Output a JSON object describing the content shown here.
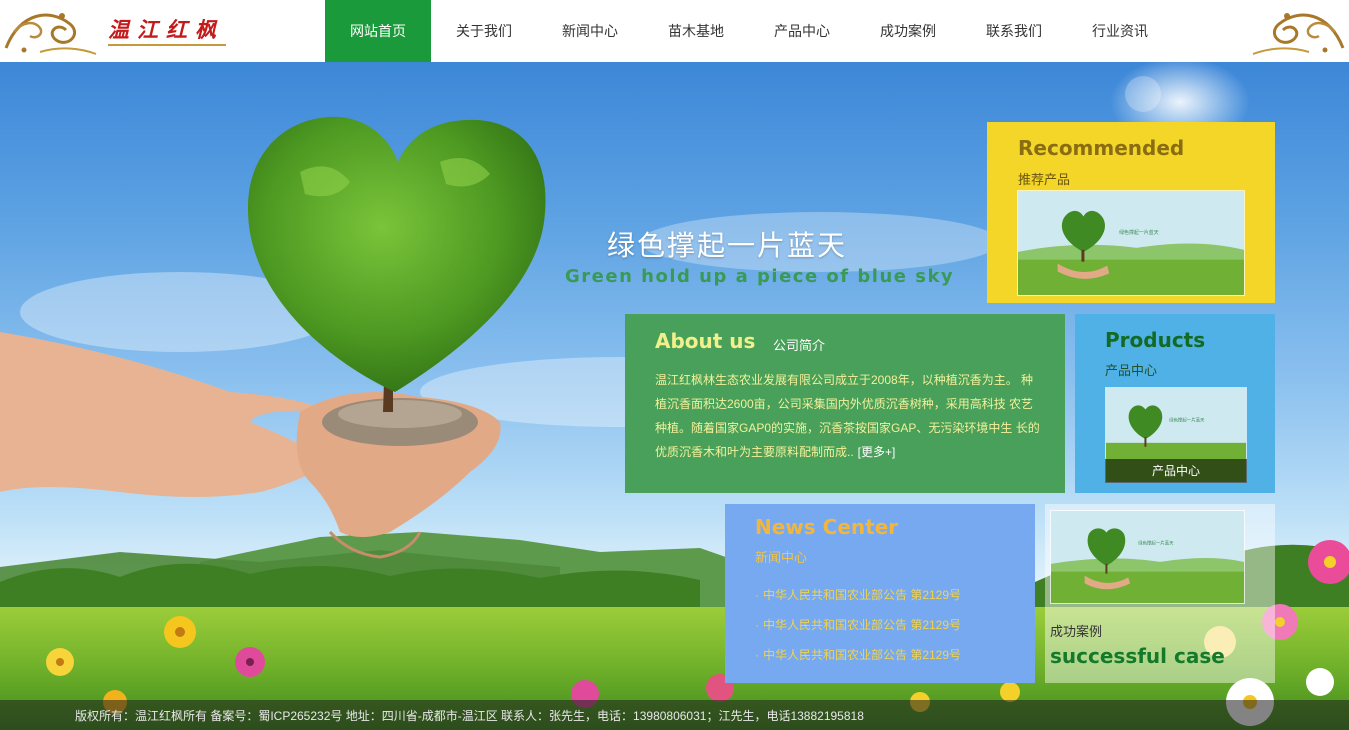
{
  "logo": {
    "text": "温江红枫"
  },
  "nav": {
    "items": [
      {
        "label": "网站首页"
      },
      {
        "label": "关于我们"
      },
      {
        "label": "新闻中心"
      },
      {
        "label": "苗木基地"
      },
      {
        "label": "产品中心"
      },
      {
        "label": "成功案例"
      },
      {
        "label": "联系我们"
      },
      {
        "label": "行业资讯"
      }
    ],
    "active_index": 0
  },
  "hero": {
    "slogan_cn": "绿色撑起一片蓝天",
    "slogan_en": "Green hold up a piece of blue sky"
  },
  "recommended": {
    "title": "Recommended",
    "subtitle": "推荐产品"
  },
  "about": {
    "title": "About us",
    "subtitle": "公司简介",
    "body": "温江红枫林生态农业发展有限公司成立于2008年，以种植沉香为主。 种植沉香面积达2600亩，公司采集国内外优质沉香树种，采用高科技 农艺种植。随着国家GAP0的实施，沉香茶按国家GAP、无污染环境中生 长的优质沉香木和叶为主要原料配制而成..",
    "more_label": "[更多+]"
  },
  "products": {
    "title": "Products",
    "subtitle": "产品中心",
    "caption": "产品中心"
  },
  "news": {
    "title": "News Center",
    "subtitle": "新闻中心",
    "items": [
      "中华人民共和国农业部公告 第2129号",
      "中华人民共和国农业部公告 第2129号",
      "中华人民共和国农业部公告 第2129号"
    ]
  },
  "cases": {
    "subtitle": "成功案例",
    "title": "successful case"
  },
  "footer": {
    "text": "版权所有：温江红枫所有 备案号：蜀ICP265232号 地址：四川省-成都市-温江区 联系人：张先生，电话：13980806031；江先生，电话13882195818"
  },
  "colors": {
    "nav_active": "#1a9a3a",
    "recommended_bg": "#f3d628",
    "about_bg": "#48a05a",
    "products_bg": "#4fb1e6",
    "news_bg": "#77a9f1"
  }
}
